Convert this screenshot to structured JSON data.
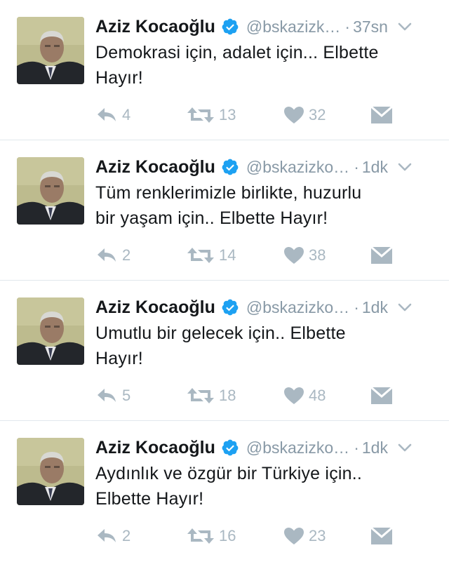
{
  "author": {
    "name": "Aziz Kocaoğlu"
  },
  "colors": {
    "verified": "#1da1f2",
    "icon_gray": "#aab8c2",
    "meta_gray": "#8899a6",
    "divider": "#e1e8ed"
  },
  "icons": [
    "verified-badge-icon",
    "chevron-down-icon",
    "reply-icon",
    "retweet-icon",
    "heart-icon",
    "direct-message-icon"
  ],
  "tweets": [
    {
      "name": "Aziz Kocaoğlu",
      "handle": "@bskazizk…",
      "time": "37sn",
      "text_line1": "Demokrasi için, adalet için... Elbette",
      "text_line2": "Hayır!",
      "replies": "4",
      "retweets": "13",
      "likes": "32"
    },
    {
      "name": "Aziz Kocaoğlu",
      "handle": "@bskazizko…",
      "time": "1dk",
      "text_line1": "Tüm renklerimizle birlikte, huzurlu",
      "text_line2": "bir yaşam için.. Elbette Hayır!",
      "replies": "2",
      "retweets": "14",
      "likes": "38"
    },
    {
      "name": "Aziz Kocaoğlu",
      "handle": "@bskazizko…",
      "time": "1dk",
      "text_line1": "Umutlu bir gelecek için..  Elbette",
      "text_line2": "Hayır!",
      "replies": "5",
      "retweets": "18",
      "likes": "48"
    },
    {
      "name": "Aziz Kocaoğlu",
      "handle": "@bskazizko…",
      "time": "1dk",
      "text_line1": "Aydınlık ve özgür bir Türkiye için..",
      "text_line2": "Elbette Hayır!",
      "replies": "2",
      "retweets": "16",
      "likes": "23"
    }
  ]
}
